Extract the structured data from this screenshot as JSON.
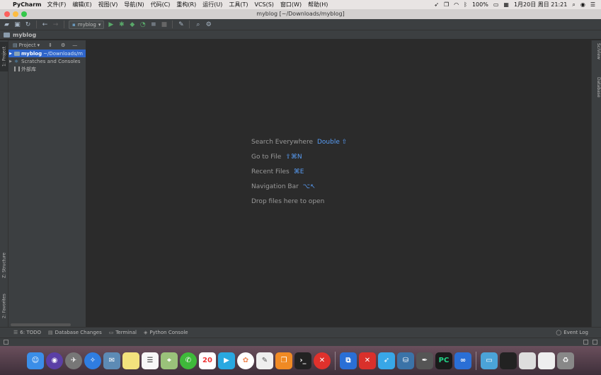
{
  "menubar": {
    "app_name": "PyCharm",
    "items": [
      "文件(F)",
      "编辑(E)",
      "视图(V)",
      "导航(N)",
      "代码(C)",
      "重构(R)",
      "运行(U)",
      "工具(T)",
      "VCS(S)",
      "窗口(W)",
      "帮助(H)"
    ],
    "battery": "100%",
    "datetime": "1月20日 周日 21:21"
  },
  "window": {
    "title": "myblog [~/Downloads/myblog]"
  },
  "toolbar": {
    "run_config": "myblog"
  },
  "navbar": {
    "project_name": "myblog"
  },
  "left_strip": {
    "project_tab": "1: Project",
    "structure_tab": "Z: Structure",
    "favorites_tab": "2: Favorites"
  },
  "project_panel": {
    "view_selector": "Project",
    "tree": [
      {
        "name": "myblog",
        "path": "~/Downloads/m"
      },
      {
        "name": "Scratches and Consoles"
      },
      {
        "name": "外部库"
      }
    ]
  },
  "editor": {
    "hints": [
      {
        "text": "Search Everywhere",
        "key": "Double ⇧"
      },
      {
        "text": "Go to File",
        "key": "⇧⌘N"
      },
      {
        "text": "Recent Files",
        "key": "⌘E"
      },
      {
        "text": "Navigation Bar",
        "key": "⌥↖"
      },
      {
        "text": "Drop files here to open",
        "key": ""
      }
    ]
  },
  "right_strip": {
    "sciview_tab": "SciView",
    "database_tab": "Database"
  },
  "bottom_bar": {
    "tabs": [
      "6: TODO",
      "Database Changes",
      "Terminal",
      "Python Console"
    ],
    "event_log": "Event Log"
  },
  "dock": {
    "calendar_day": "20"
  }
}
